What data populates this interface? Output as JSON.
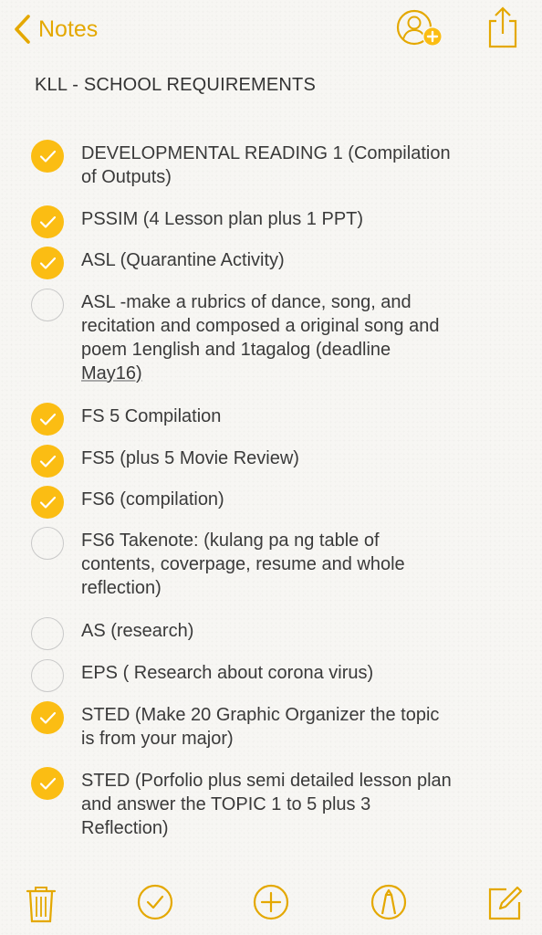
{
  "nav": {
    "back_label": "Notes"
  },
  "note": {
    "title": "KLL - SCHOOL REQUIREMENTS",
    "items": [
      {
        "checked": true,
        "lines": [
          "DEVELOPMENTAL READING 1 (Compilation",
          "of Outputs)"
        ]
      },
      {
        "checked": true,
        "lines": [
          "PSSIM (4 Lesson plan plus 1 PPT)"
        ]
      },
      {
        "checked": true,
        "lines": [
          "ASL (Quarantine Activity)"
        ]
      },
      {
        "checked": false,
        "lines": [
          "ASL -make a rubrics of dance, song, and",
          "recitation and composed a original song and",
          "poem 1english and 1tagalog (deadline",
          "May16)"
        ]
      },
      {
        "checked": true,
        "lines": [
          "FS 5  Compilation"
        ]
      },
      {
        "checked": true,
        "lines": [
          "FS5 (plus 5 Movie Review)"
        ]
      },
      {
        "checked": true,
        "lines": [
          "FS6 (compilation)"
        ]
      },
      {
        "checked": false,
        "lines": [
          "FS6 Takenote: (kulang pa ng table of",
          "contents, coverpage, resume and whole",
          "reflection)"
        ]
      },
      {
        "checked": false,
        "lines": [
          "AS (research)"
        ]
      },
      {
        "checked": false,
        "lines": [
          "EPS ( Research about corona virus)"
        ]
      },
      {
        "checked": true,
        "lines": [
          "STED (Make 20 Graphic Organizer the topic",
          "is from your major)"
        ]
      },
      {
        "checked": true,
        "lines": [
          "STED (Porfolio plus semi detailed lesson plan",
          "and answer the TOPIC 1 to 5 plus  3",
          "Reflection)"
        ]
      }
    ]
  },
  "toolbar": {
    "icons": [
      "trash-icon",
      "checklist-icon",
      "add-icon",
      "markup-icon",
      "compose-icon"
    ]
  },
  "colors": {
    "accent": "#e4a800",
    "check_fill": "#fbbd13",
    "unchecked_border": "#c9c9c9"
  }
}
